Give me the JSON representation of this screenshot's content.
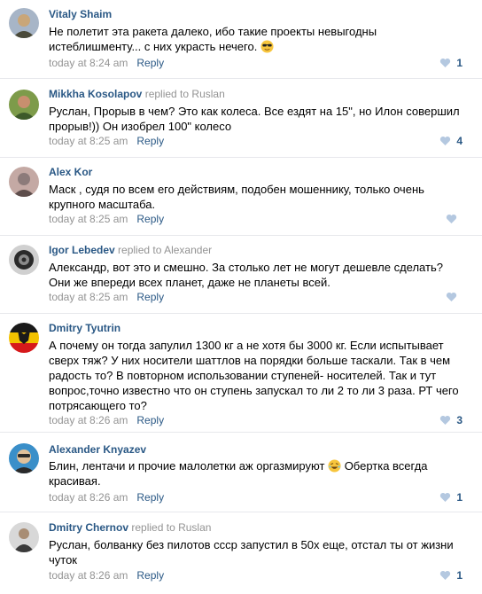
{
  "comments": [
    {
      "author": "Vitaly Shaim",
      "reply_prefix": "",
      "reply_to": "",
      "text": "Не полетит эта ракета далеко, ибо такие проекты невыгодны истеблишменту... с них украсть нечего.",
      "emoji": "sunglasses-emoji",
      "time": "today at 8:24 am",
      "reply_label": "Reply",
      "likes": "1",
      "avatar_colors": [
        "#4a4a3a",
        "#c9a678",
        "#a7b5c7"
      ]
    },
    {
      "author": "Mikkha Kosolapov",
      "reply_prefix": "replied to",
      "reply_to": "Ruslan",
      "text": "Руслан, Прорыв в чем? Это как колеса. Все ездят на 15\", но Илон совершил прорыв!)) Он изобрел 100\" колесо",
      "emoji": "",
      "time": "today at 8:25 am",
      "reply_label": "Reply",
      "likes": "4",
      "avatar_colors": [
        "#7d9b4a",
        "#c88f6e",
        "#3d5a2a"
      ]
    },
    {
      "author": "Alex Kor",
      "reply_prefix": "",
      "reply_to": "",
      "text": "Маск , судя по всем его действиям, подобен мошеннику, только очень крупного масштаба.",
      "emoji": "",
      "time": "today at 8:25 am",
      "reply_label": "Reply",
      "likes": "",
      "avatar_colors": [
        "#8c7b7a",
        "#c4a9a4",
        "#5e4e4c"
      ]
    },
    {
      "author": "Igor Lebedev",
      "reply_prefix": "replied to",
      "reply_to": "Alexander",
      "text": "Александр, вот это и смешно. За столько лет не могут дешевле сделать? Они же впереди всех планет, даже не планеты всей.",
      "emoji": "",
      "time": "today at 8:25 am",
      "reply_label": "Reply",
      "likes": "",
      "avatar_colors": [
        "#2a2a2a",
        "#8a8a8a",
        "#d0d0d0"
      ]
    },
    {
      "author": "Dmitry Tyutrin",
      "reply_prefix": "",
      "reply_to": "",
      "text": "А почему он тогда запулил 1300 кг а не хотя бы 3000 кг. Если испытывает сверх тяж? У них носители шаттлов на порядки больше таскали. Так в чем радость то? В повторном использовании ступеней- носителей. Так и тут вопрос,точно известно что он ступень запускал то ли 2 то ли 3 раза. РТ чего потрясающего то?",
      "emoji": "",
      "time": "today at 8:26 am",
      "reply_label": "Reply",
      "likes": "3",
      "avatar_colors": [
        "#f2c200",
        "#1a1a1a",
        "#d6191b"
      ]
    },
    {
      "author": "Alexander Knyazev",
      "reply_prefix": "",
      "reply_to": "",
      "text": "Блин, лентачи и прочие малолетки аж оргазмируют",
      "text_after": "Обертка всегда красивая.",
      "emoji": "rofl-emoji",
      "time": "today at 8:26 am",
      "reply_label": "Reply",
      "likes": "1",
      "avatar_colors": [
        "#3a8fc9",
        "#e0c09a",
        "#2a2a2a"
      ]
    },
    {
      "author": "Dmitry Chernov",
      "reply_prefix": "replied to",
      "reply_to": "Ruslan",
      "text": "Руслан, болванку без пилотов ссср запустил в 50х еще, отстал ты от жизни чуток",
      "emoji": "",
      "time": "today at 8:26 am",
      "reply_label": "Reply",
      "likes": "1",
      "avatar_colors": [
        "#d8d8d8",
        "#3a3a3a",
        "#a88d74"
      ]
    }
  ],
  "colors": {
    "link": "#2a5885",
    "muted": "#939393",
    "divider": "#e7e8ec",
    "like_heart_active": "#5181b8",
    "like_heart_idle": "#b4c8e0"
  }
}
